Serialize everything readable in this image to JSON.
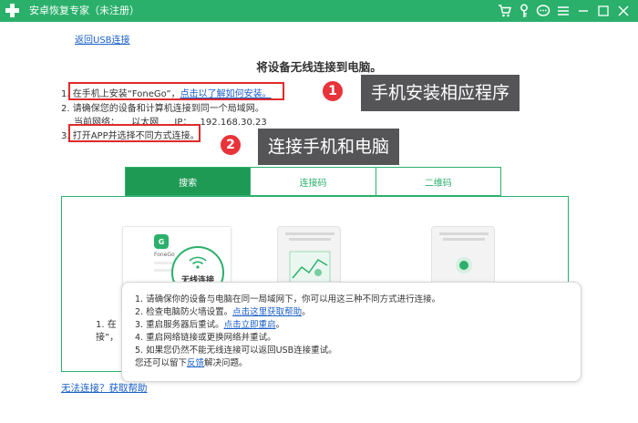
{
  "window": {
    "title": "安卓恢复专家（未注册）",
    "icons": [
      "app-plus-icon",
      "cart-icon",
      "key-icon",
      "chat-icon",
      "menu-icon",
      "minimize-icon",
      "maximize-icon",
      "close-icon"
    ]
  },
  "back_link": "返回USB连接",
  "heading": "将设备无线连接到电脑。",
  "steps": {
    "s1_prefix": "1. 在手机上安装“FoneGo”，",
    "s1_link": "点击以了解如何安装。",
    "s2": "2. 请确保您的设备和计算机连接到同一个局域网。",
    "net_label": "当前网络：",
    "net_type": "以太网",
    "ip_label": "IP：",
    "ip_value": "192.168.30.23",
    "s3": "3. 打开APP并选择不同方式连接。"
  },
  "callouts": [
    {
      "num": "1",
      "text": "手机安装相应程序"
    },
    {
      "num": "2",
      "text": "连接手机和电脑"
    }
  ],
  "tabs": [
    {
      "label": "搜索",
      "active": true
    },
    {
      "label": "连接码",
      "active": false
    },
    {
      "label": "二维码",
      "active": false
    }
  ],
  "card": {
    "app_name": "FoneGo",
    "wifi_label": "无线连接"
  },
  "left_text": {
    "line1": "1. 在",
    "line2": "接”，"
  },
  "popup": {
    "l1": "1.  请确保你的设备与电脑在同一局域网下，你可以用这三种不同方式进行连接。",
    "l2_prefix": "2.  检查电脑防火墙设置。",
    "l2_link": "点击这里获取帮助",
    "l2_suffix": "。",
    "l3_prefix": "3.  重启服务器后重试。",
    "l3_link": "点击立即重启",
    "l3_suffix": "。",
    "l4": "4.  重启网络链接或更换网络并重试。",
    "l5": "5.  如果您仍然不能无线连接可以返回USB连接重试。",
    "l6_prefix": "您还可以留下",
    "l6_link": "反馈",
    "l6_suffix": "解决问题。"
  },
  "help_link": "无法连接？获取帮助",
  "colors": {
    "brand_green": "#2bb06b",
    "active_tab": "#1e9a55",
    "link_blue": "#1a5fc9",
    "highlight_red": "#e02a2a",
    "callout_bg": "#555557"
  }
}
